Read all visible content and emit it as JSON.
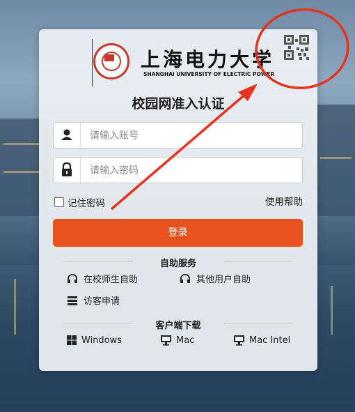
{
  "logo": {
    "name_cn": "上海电力大学",
    "name_en": "SHANGHAI UNIVERSITY OF ELECTRIC POWER"
  },
  "page_title": "校园网准入认证",
  "account": {
    "placeholder": "请输入账号",
    "icon": "user-icon"
  },
  "password": {
    "placeholder": "请输入密码",
    "icon": "lock-icon"
  },
  "remember_label": "记住密码",
  "help_label": "使用帮助",
  "login_label": "登录",
  "self_service": {
    "heading": "自助服务",
    "items": [
      {
        "label": "在校师生自助",
        "icon": "headset-icon"
      },
      {
        "label": "其他用户自助",
        "icon": "headset-icon"
      },
      {
        "label": "访客申请",
        "icon": "list-icon"
      }
    ]
  },
  "downloads": {
    "heading": "客户端下载",
    "items": [
      {
        "label": "Windows",
        "icon": "windows-icon"
      },
      {
        "label": "Mac",
        "icon": "monitor-icon"
      },
      {
        "label": "Mac Intel",
        "icon": "monitor-icon"
      }
    ]
  },
  "colors": {
    "accent": "#e65320",
    "annotation": "#e8321e",
    "seal": "#c33a2a"
  }
}
